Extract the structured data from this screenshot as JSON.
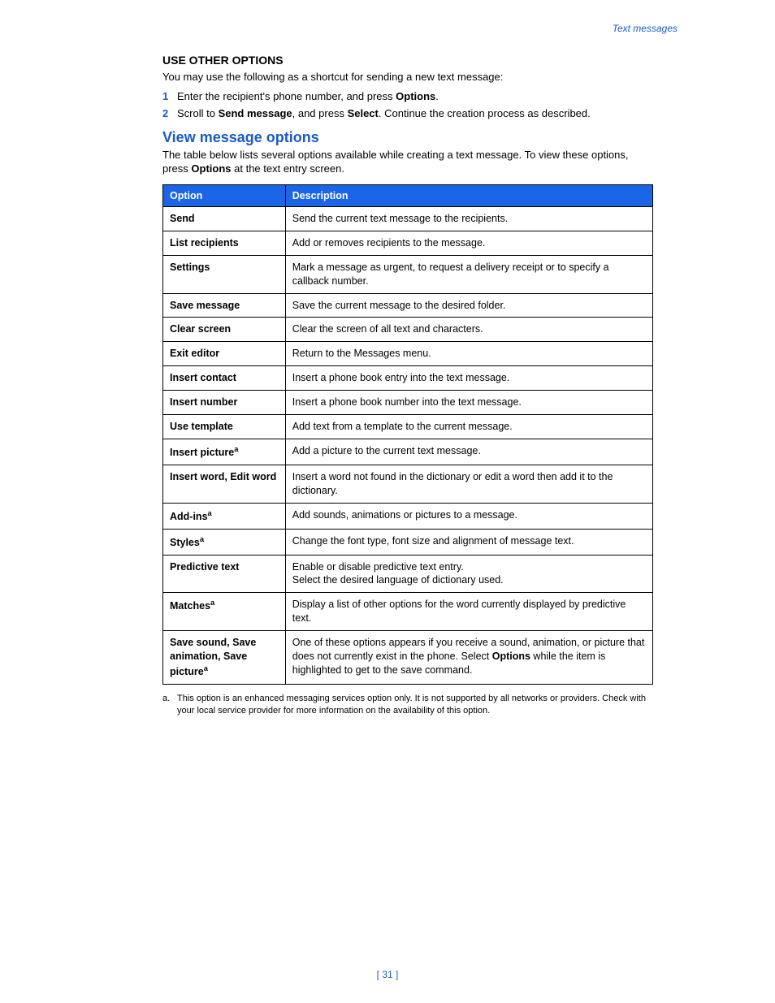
{
  "running_head": "Text messages",
  "section1": {
    "heading": "USE OTHER OPTIONS",
    "intro": "You may use the following as a shortcut for sending a new text message:",
    "steps": [
      {
        "num": "1",
        "pre": "Enter the recipient's phone number, and press ",
        "bold": "Options",
        "post": "."
      },
      {
        "num": "2",
        "pre": "Scroll to ",
        "bold1": "Send message",
        "mid": ", and press ",
        "bold2": "Select",
        "post": ". Continue the creation process as described."
      }
    ]
  },
  "section2": {
    "heading": "View message options",
    "intro_pre": "The table below lists several options available while creating a text message. To view these options, press ",
    "intro_bold": "Options",
    "intro_post": " at the text entry screen."
  },
  "table": {
    "headers": {
      "option": "Option",
      "description": "Description"
    },
    "rows": [
      {
        "option": "Send",
        "sup": "",
        "desc": "Send the current text message to the recipients."
      },
      {
        "option": "List recipients",
        "sup": "",
        "desc": "Add or removes recipients to the message."
      },
      {
        "option": "Settings",
        "sup": "",
        "desc": "Mark a message as urgent, to request a delivery receipt or to specify a callback number."
      },
      {
        "option": "Save message",
        "sup": "",
        "desc": "Save the current message to the desired folder."
      },
      {
        "option": "Clear screen",
        "sup": "",
        "desc": "Clear the screen of all text and characters."
      },
      {
        "option": "Exit editor",
        "sup": "",
        "desc": "Return to the Messages menu."
      },
      {
        "option": "Insert contact",
        "sup": "",
        "desc": "Insert a phone book entry into the text message."
      },
      {
        "option": "Insert number",
        "sup": "",
        "desc": "Insert a phone book number into the text message."
      },
      {
        "option": "Use template",
        "sup": "",
        "desc": "Add text from a template to the current message."
      },
      {
        "option": "Insert picture",
        "sup": "a",
        "desc": "Add a picture to the current text message."
      },
      {
        "option": "Insert word, Edit word",
        "sup": "",
        "desc": "Insert a word not found in the dictionary or edit a word then add it to the dictionary."
      },
      {
        "option": "Add-ins",
        "sup": "a",
        "desc": "Add sounds, animations or pictures to a message."
      },
      {
        "option": "Styles",
        "sup": "a",
        "desc": "Change the font type, font size and alignment of message text."
      },
      {
        "option": "Predictive text",
        "sup": "",
        "desc": "Enable or disable predictive text entry.\nSelect the desired language of dictionary used."
      },
      {
        "option": "Matches",
        "sup": "a",
        "desc": "Display a list of other options for the word currently displayed by predictive text."
      },
      {
        "option": "Save sound, Save animation, Save picture",
        "sup": "a",
        "desc_pre": "One of these options appears if you receive a sound, animation, or picture that does not currently exist in the phone. Select ",
        "desc_bold": "Options",
        "desc_post": " while the item is highlighted to get to the save command."
      }
    ]
  },
  "footnote": {
    "label": "a.",
    "text": "This option is an enhanced messaging services option only. It is not supported by all networks or providers. Check with your local service provider for more information on the availability of this option."
  },
  "page_number": "31"
}
